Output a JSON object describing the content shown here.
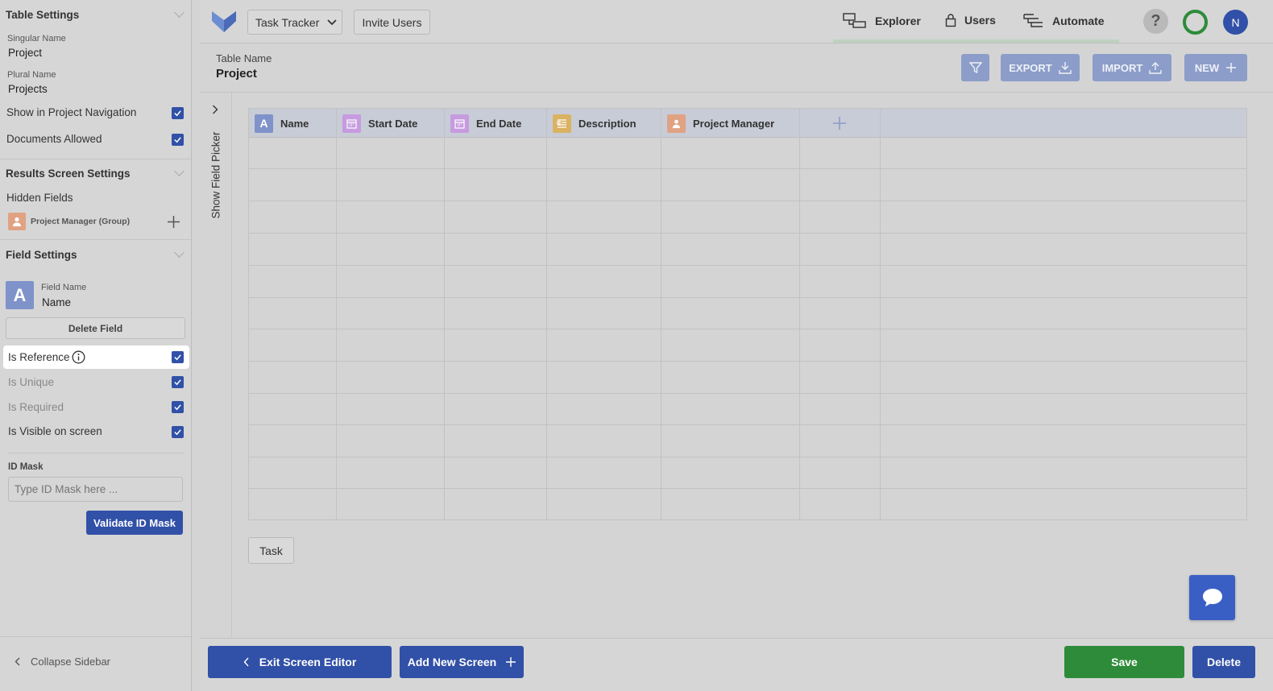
{
  "sidebar": {
    "table_settings": {
      "title": "Table Settings",
      "singular_label": "Singular Name",
      "singular_value": "Project",
      "plural_label": "Plural Name",
      "plural_value": "Projects",
      "show_nav_label": "Show in Project Navigation",
      "show_nav_checked": true,
      "docs_label": "Documents Allowed",
      "docs_checked": true
    },
    "results_settings": {
      "title": "Results Screen Settings",
      "hidden_fields_label": "Hidden Fields",
      "hidden_field_item": "Project Manager (Group)"
    },
    "field_settings": {
      "title": "Field Settings",
      "field_icon_letter": "A",
      "field_name_label": "Field Name",
      "field_name_value": "Name",
      "delete_label": "Delete Field",
      "is_reference_label": "Is Reference",
      "is_unique_label": "Is Unique",
      "is_required_label": "Is Required",
      "is_visible_label": "Is Visible on screen",
      "id_mask_label": "ID Mask",
      "id_mask_placeholder": "Type ID Mask here ...",
      "id_mask_value": "",
      "validate_label": "Validate ID Mask"
    },
    "collapse_label": "Collapse Sidebar"
  },
  "topbar": {
    "app_select": "Task Tracker",
    "invite_label": "Invite Users",
    "nav": [
      {
        "label": "Explorer",
        "icon": "explorer-icon",
        "active": true
      },
      {
        "label": "Users",
        "icon": "lock-icon",
        "active": false
      },
      {
        "label": "Automate",
        "icon": "automate-icon",
        "active": false
      }
    ],
    "help_label": "?",
    "avatar_initial": "N"
  },
  "table_header": {
    "label": "Table Name",
    "value": "Project",
    "export_label": "EXPORT",
    "import_label": "IMPORT",
    "new_label": "NEW"
  },
  "field_picker_label": "Show Field Picker",
  "grid": {
    "columns": [
      {
        "label": "Name",
        "icon": "text-field-icon",
        "icon_text": "A",
        "color": "#7f92c9"
      },
      {
        "label": "Start Date",
        "icon": "calendar-icon",
        "icon_text": "",
        "color": "#c79be0"
      },
      {
        "label": "End Date",
        "icon": "calendar-icon",
        "icon_text": "",
        "color": "#c79be0"
      },
      {
        "label": "Description",
        "icon": "text-lines-icon",
        "icon_text": "",
        "color": "#d9b262"
      },
      {
        "label": "Project Manager",
        "icon": "person-icon",
        "icon_text": "",
        "color": "#e0a283"
      }
    ],
    "empty_rows": 12
  },
  "screen_tab": "Task",
  "bottom": {
    "exit_label": "Exit Screen Editor",
    "add_screen_label": "Add New Screen",
    "save_label": "Save",
    "delete_label": "Delete"
  },
  "colors": {
    "primary": "#3150a7",
    "save_green": "#2e8b39",
    "accent_faded": "#8c9dc9"
  }
}
